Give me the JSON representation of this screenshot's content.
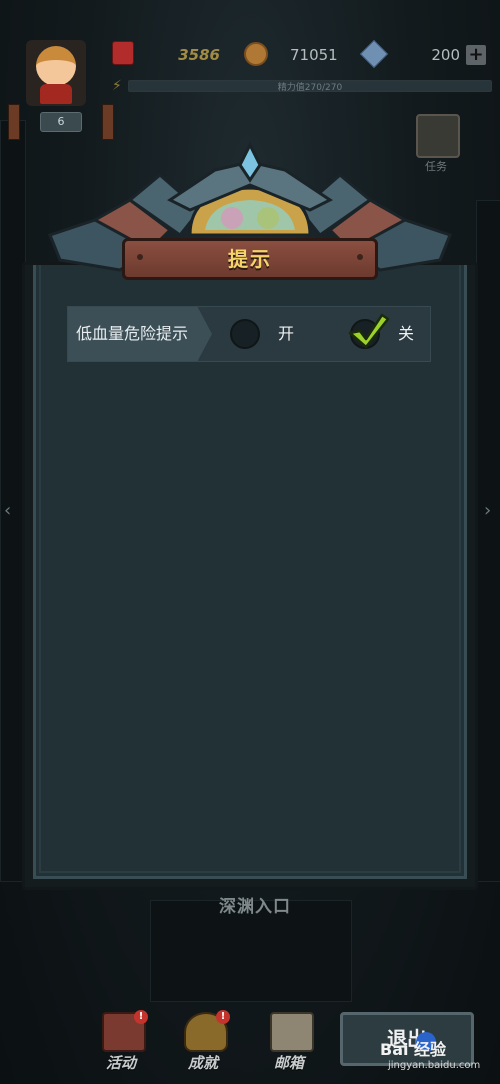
{
  "hud": {
    "gold": "3586",
    "coins": "71051",
    "gems": "200",
    "add_symbol": "+",
    "energy_text": "精力值270/270",
    "level": "6",
    "task_label": "任务"
  },
  "dialog": {
    "title": "提示",
    "setting": {
      "label": "低血量危险提示",
      "option_on": "开",
      "option_off": "关",
      "selected": "关"
    }
  },
  "scene": {
    "entrance_label": "深渊入口"
  },
  "bottom_nav": {
    "items": [
      {
        "label": "活动",
        "badge": "!",
        "icon": "activity-icon"
      },
      {
        "label": "成就",
        "badge": "!",
        "icon": "achievement-icon"
      },
      {
        "label": "邮箱",
        "badge": "",
        "icon": "mail-icon"
      }
    ],
    "exit_label": "退出"
  },
  "watermark": {
    "main": "Bai 经验",
    "sub": "jingyan.baidu.com"
  },
  "colors": {
    "title_text": "#f3d36a",
    "check_mark": "#9bd12b",
    "badge": "#c2342c"
  }
}
